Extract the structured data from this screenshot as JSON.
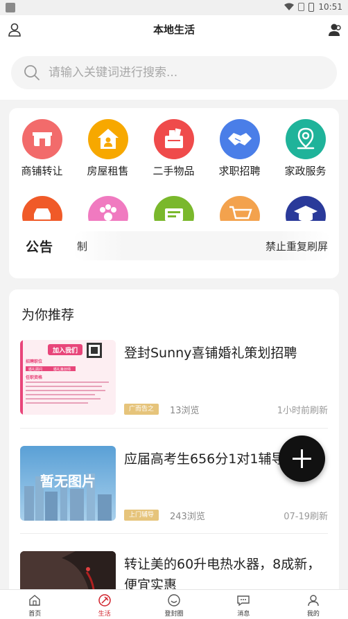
{
  "status_bar": {
    "time": "10:51"
  },
  "header": {
    "title": "本地生活"
  },
  "search": {
    "placeholder": "请输入关键词进行搜索..."
  },
  "categories": [
    {
      "label": "商铺转让",
      "icon": "shop-icon",
      "color": "#f26b6b"
    },
    {
      "label": "房屋租售",
      "icon": "house-icon",
      "color": "#f7a800"
    },
    {
      "label": "二手物品",
      "icon": "bag-icon",
      "color": "#ef4b4b"
    },
    {
      "label": "求职招聘",
      "icon": "handshake-icon",
      "color": "#4a7ee8"
    },
    {
      "label": "家政服务",
      "icon": "location-icon",
      "color": "#1fb39a"
    }
  ],
  "categories_row2": [
    {
      "icon": "car-icon",
      "color": "#f05a28"
    },
    {
      "icon": "paw-icon",
      "color": "#f07ac0"
    },
    {
      "icon": "ticket-icon",
      "color": "#7ab82c"
    },
    {
      "icon": "cart-icon",
      "color": "#f3a24d"
    },
    {
      "icon": "graduation-icon",
      "color": "#2a3a9a"
    }
  ],
  "notice": {
    "logo": "公告",
    "text_left": "制",
    "text_right": "禁止重复刷屏"
  },
  "recommend": {
    "title": "为你推荐",
    "posts": [
      {
        "title": "登封Sunny喜铺婚礼策划招聘",
        "tag": "广而告之",
        "views": "13浏览",
        "time": "1小时前刷新",
        "thumb_heading": "加入我们",
        "thumb_lines": [
          "招聘职位",
          "婚礼顾问",
          "婚礼策划师",
          "任职资格"
        ]
      },
      {
        "title": "应届高考生656分1对1辅导",
        "tag": "上门辅导",
        "views": "243浏览",
        "time": "07-19刷新",
        "thumb_text": "暂无图片"
      },
      {
        "title": "转让美的60升电热水器，8成新，便宜实惠"
      }
    ]
  },
  "tabbar": [
    {
      "label": "首页",
      "icon": "home-icon"
    },
    {
      "label": "生活",
      "icon": "life-icon",
      "active": true
    },
    {
      "label": "登封圈",
      "icon": "circle-icon"
    },
    {
      "label": "消息",
      "icon": "message-icon"
    },
    {
      "label": "我的",
      "icon": "profile-icon"
    }
  ],
  "colors": {
    "accent": "#d0202a",
    "tag_bg": "#e6c47b"
  }
}
